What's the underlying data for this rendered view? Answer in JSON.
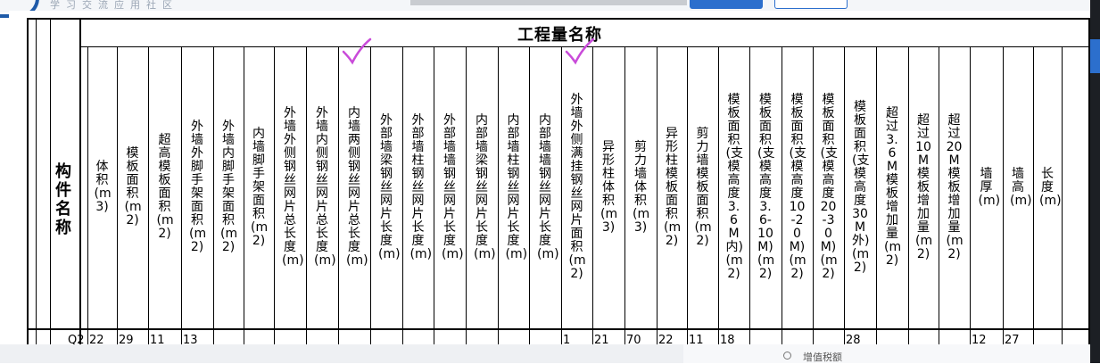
{
  "top": {
    "site_name": "学习交流应用社区"
  },
  "table": {
    "title": "工程量名称",
    "row_header": "构件名称",
    "columns": [
      "体积(m3)",
      "模板面积(m2)",
      "超高模板面积(m2)",
      "外墙外脚手架面积(m2)",
      "外墙内脚手架面积(m2)",
      "内墙脚手架面积(m2)",
      "外墙外侧钢丝网片总长度(m)",
      "外墙内侧钢丝网片总长度(m)",
      "内墙两侧钢丝网片总长度(m)",
      "外部墙梁钢丝网片长度(m)",
      "外部墙柱钢丝网片长度(m)",
      "外部墙墙钢丝网片长度(m)",
      "内部墙梁钢丝网片长度(m)",
      "内部墙柱钢丝网片长度(m)",
      "内部墙墙钢丝网片长度(m)",
      "外墙外侧满挂钢丝网片面积(m2)",
      "异形柱体积(m3)",
      "剪力墙体积(m3)",
      "异形柱模板面积(m2)",
      "剪力墙模板面积(m2)",
      "模板面积(支模高度3.6M内)(m2)",
      "模板面积(支模高度3.6-10M)(m2)",
      "模板面积(支模高度10-20M)(m2)",
      "模板面积(支模高度20-30M)(m2)",
      "模板面积(支模高度30M外)(m2)",
      "超过3.6M模板增加量(m2)",
      "超过10M模板增加量(m2)",
      "超过20M模板增加量(m2)",
      "墙厚(m)",
      "墙高(m)",
      "长度(m)"
    ],
    "row_values": [
      "Q2",
      "22",
      "29",
      "11",
      "13",
      "",
      "",
      "",
      "",
      "",
      "",
      "",
      "",
      "",
      "",
      "",
      "1",
      "21",
      "70",
      "22",
      "11",
      "18",
      "",
      "",
      "",
      "28",
      "",
      "",
      "",
      "12",
      "27"
    ]
  },
  "annotations": {
    "check_color": "#c94bd9",
    "checked_columns": [
      8,
      15
    ]
  },
  "bottom": {
    "panel_text": "增值税额"
  }
}
